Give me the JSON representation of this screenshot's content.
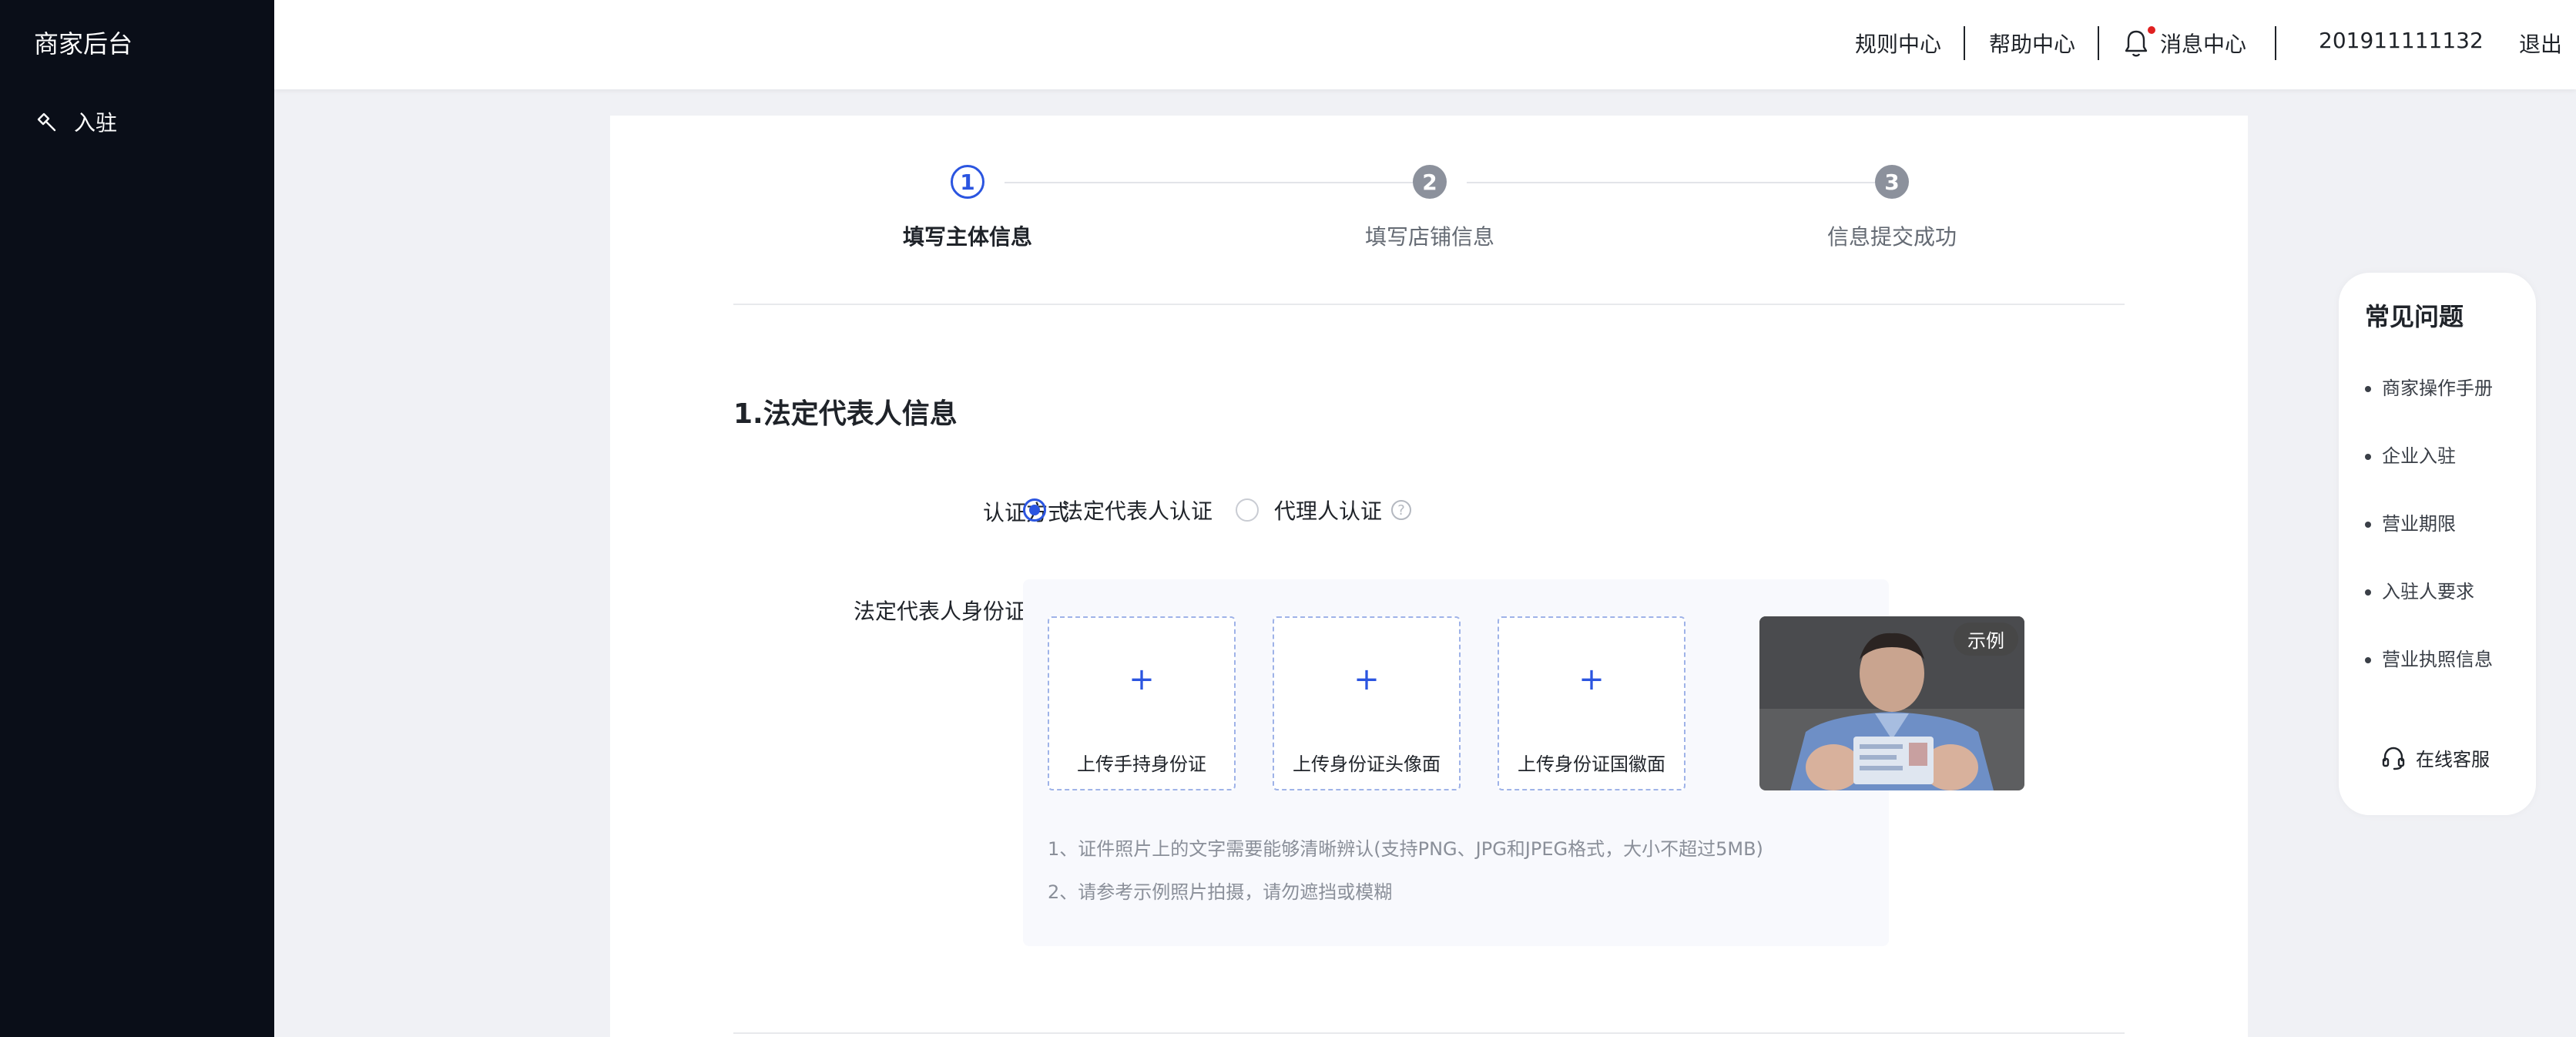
{
  "sidebar": {
    "brand": "商家后台",
    "items": [
      {
        "label": "入驻",
        "icon": "hammer-icon"
      }
    ]
  },
  "topbar": {
    "rules": "规则中心",
    "help": "帮助中心",
    "messages": "消息中心",
    "user_id": "201911111132",
    "logout": "退出"
  },
  "steps": [
    {
      "number": "1",
      "label": "填写主体信息",
      "state": "active"
    },
    {
      "number": "2",
      "label": "填写店铺信息",
      "state": "inactive"
    },
    {
      "number": "3",
      "label": "信息提交成功",
      "state": "inactive"
    }
  ],
  "section": {
    "title": "1.法定代表人信息",
    "auth_label": "认证方式",
    "auth_options": [
      {
        "label": "法定代表人认证",
        "checked": true
      },
      {
        "label": "代理人认证",
        "checked": false
      }
    ],
    "help_symbol": "?",
    "id_photo_label": "法定代表人身份证照片",
    "upload_plus": "+",
    "uploads": [
      "上传手持身份证",
      "上传身份证头像面",
      "上传身份证国徽面"
    ],
    "sample_tag": "示例",
    "notes": [
      "1、证件照片上的文字需要能够清晰辨认(支持PNG、JPG和JPEG格式，大小不超过5MB)",
      "2、请参考示例照片拍摄，请勿遮挡或模糊"
    ]
  },
  "faq": {
    "title": "常见问题",
    "items": [
      "商家操作手册",
      "企业入驻",
      "营业期限",
      "入驻人要求",
      "营业执照信息"
    ],
    "service": "在线客服"
  },
  "colors": {
    "accent": "#2b55e0",
    "sidebar_bg": "#0a0e18",
    "page_bg": "#f0f1f5"
  }
}
